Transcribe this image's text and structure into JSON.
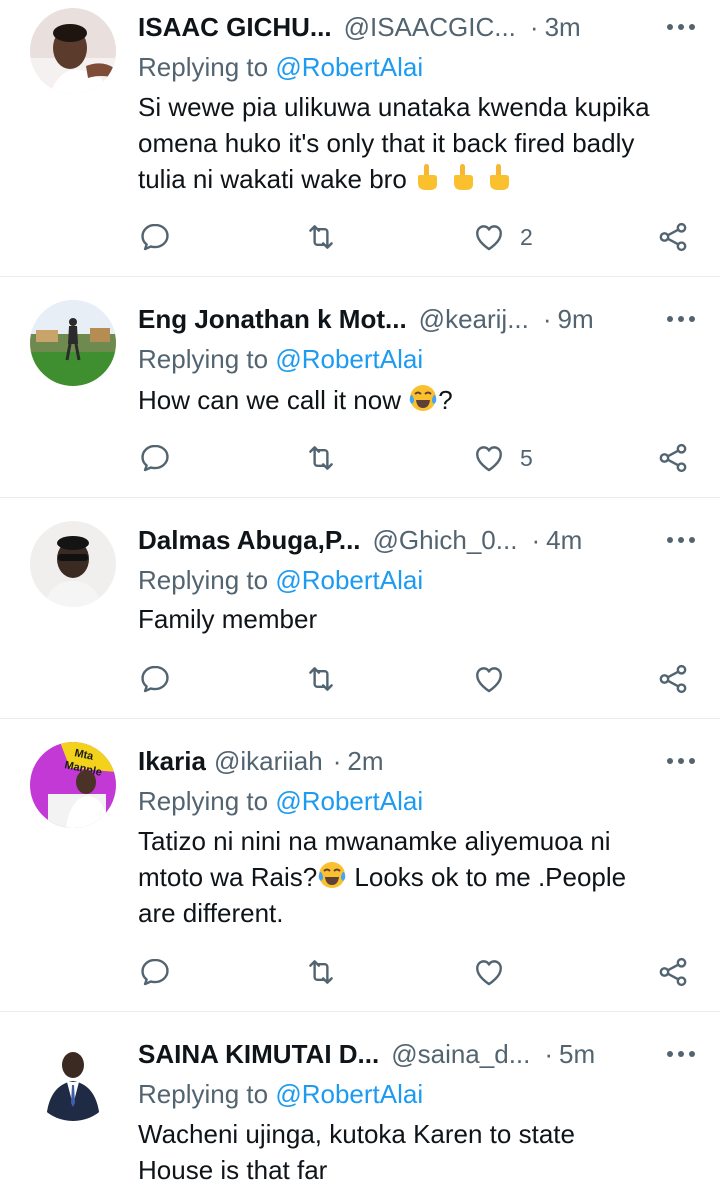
{
  "tweets": [
    {
      "name": "ISAAC GICHU...",
      "handle": "@ISAACGIC...",
      "dot": "·",
      "time": "3m",
      "replying_prefix": "Replying to ",
      "replying_to": "@RobertAlai",
      "text_lines": [
        "Si wewe pia ulikuwa unataka kwenda kupika",
        "omena huko it's only that it back fired badly",
        "tulia ni wakati wake bro"
      ],
      "emoji": [
        "middle-finger-emoji",
        "middle-finger-emoji",
        "middle-finger-emoji"
      ],
      "likes": "2"
    },
    {
      "name": "Eng Jonathan k Mot...",
      "handle": "@kearij...",
      "dot": "·",
      "time": "9m",
      "replying_prefix": "Replying to ",
      "replying_to": "@RobertAlai",
      "text_before": "How can we call it now ",
      "text_after": "?",
      "emoji": [
        "tears-of-joy-emoji"
      ],
      "likes": "5"
    },
    {
      "name": "Dalmas Abuga,P...",
      "handle": "@Ghich_0...",
      "dot": "·",
      "time": "4m",
      "replying_prefix": "Replying to ",
      "replying_to": "@RobertAlai",
      "text": "Family member",
      "likes": ""
    },
    {
      "name": "Ikaria",
      "handle": "@ikariiah",
      "dot": "·",
      "time": "2m",
      "replying_prefix": "Replying to ",
      "replying_to": "@RobertAlai",
      "line1": "Tatizo ni nini na mwanamke aliyemuoa ni",
      "line2_before": "mtoto wa Rais?",
      "line2_after": " Looks ok to me .People",
      "line3": "are different.",
      "emoji": [
        "tears-of-joy-emoji"
      ],
      "avatar_text": "Mta Manple",
      "likes": ""
    },
    {
      "name": "SAINA KIMUTAI D...",
      "handle": "@saina_d...",
      "dot": "·",
      "time": "5m",
      "replying_prefix": "Replying to ",
      "replying_to": "@RobertAlai",
      "line1": "Wacheni ujinga, kutoka Karen to state",
      "line2": "House is that far"
    }
  ],
  "icons": {
    "more": "more-horizontal-icon",
    "reply": "reply-icon",
    "retweet": "retweet-icon",
    "like": "heart-icon",
    "share": "share-icon"
  },
  "colors": {
    "mention": "#1d9bf0",
    "secondary": "#536471",
    "divider": "#e6ecf0"
  }
}
